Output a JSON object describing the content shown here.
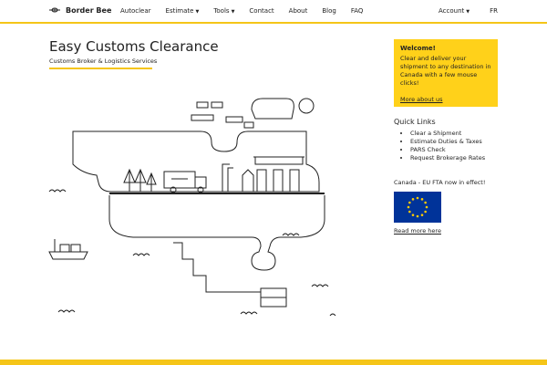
{
  "brand": {
    "name": "Border Bee",
    "accent": "#f5c518",
    "welcome_bg": "#ffd11a",
    "flag_bg": "#003399",
    "flag_star": "#ffcc00"
  },
  "nav": {
    "items": [
      {
        "label": "Autoclear"
      },
      {
        "label": "Estimate"
      },
      {
        "label": "Tools"
      },
      {
        "label": "Contact"
      },
      {
        "label": "About"
      },
      {
        "label": "Blog"
      },
      {
        "label": "FAQ"
      }
    ],
    "account": "Account",
    "lang": "FR"
  },
  "hero": {
    "title": "Easy Customs Clearance",
    "subtitle": "Customs Broker & Logistics Services"
  },
  "welcome": {
    "title": "Welcome!",
    "text": "Clear and deliver your shipment to any destination in Canada with a few mouse clicks!",
    "link": "More about us"
  },
  "quick_links": {
    "title": "Quick Links",
    "items": [
      {
        "label": "Clear a Shipment"
      },
      {
        "label": "Estimate Duties & Taxes"
      },
      {
        "label": "PARS Check"
      },
      {
        "label": "Request Brokerage Rates"
      }
    ]
  },
  "news": {
    "title": "Canada - EU FTA now in effect!",
    "link": "Read more here"
  }
}
